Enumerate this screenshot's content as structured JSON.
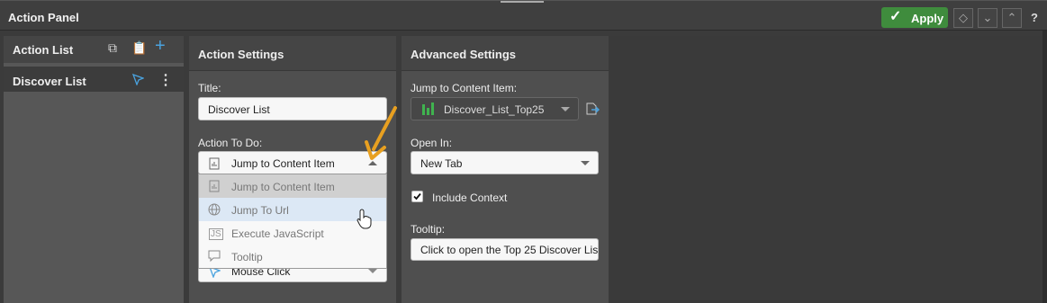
{
  "header": {
    "title": "Action Panel",
    "apply_label": "Apply",
    "help_label": "?"
  },
  "left_panel": {
    "title": "Action List",
    "items": [
      {
        "label": "Discover List"
      }
    ]
  },
  "action_settings": {
    "title": "Action Settings",
    "title_label": "Title:",
    "title_value": "Discover List",
    "action_label": "Action To Do:",
    "action_value": "Jump to Content Item",
    "trigger_value": "Mouse Click",
    "options": [
      {
        "label": "Jump to Content Item",
        "icon": "chart-doc-icon",
        "state": "selected"
      },
      {
        "label": "Jump To Url",
        "icon": "globe-icon",
        "state": "hover"
      },
      {
        "label": "Execute JavaScript",
        "icon": "js-icon",
        "state": "normal"
      },
      {
        "label": "Tooltip",
        "icon": "tooltip-icon",
        "state": "normal"
      }
    ]
  },
  "advanced_settings": {
    "title": "Advanced Settings",
    "jump_label": "Jump to Content Item:",
    "jump_value": "Discover_List_Top25",
    "open_in_label": "Open In:",
    "open_in_value": "New Tab",
    "include_context_label": "Include Context",
    "include_context_checked": true,
    "tooltip_label": "Tooltip:",
    "tooltip_value": "Click to open the Top 25 Discover Lis"
  },
  "colors": {
    "apply_green": "#3f8c3d",
    "accent_blue": "#4aa3df",
    "arrow_orange": "#e8a020",
    "chart_green": "#3fb34f"
  }
}
